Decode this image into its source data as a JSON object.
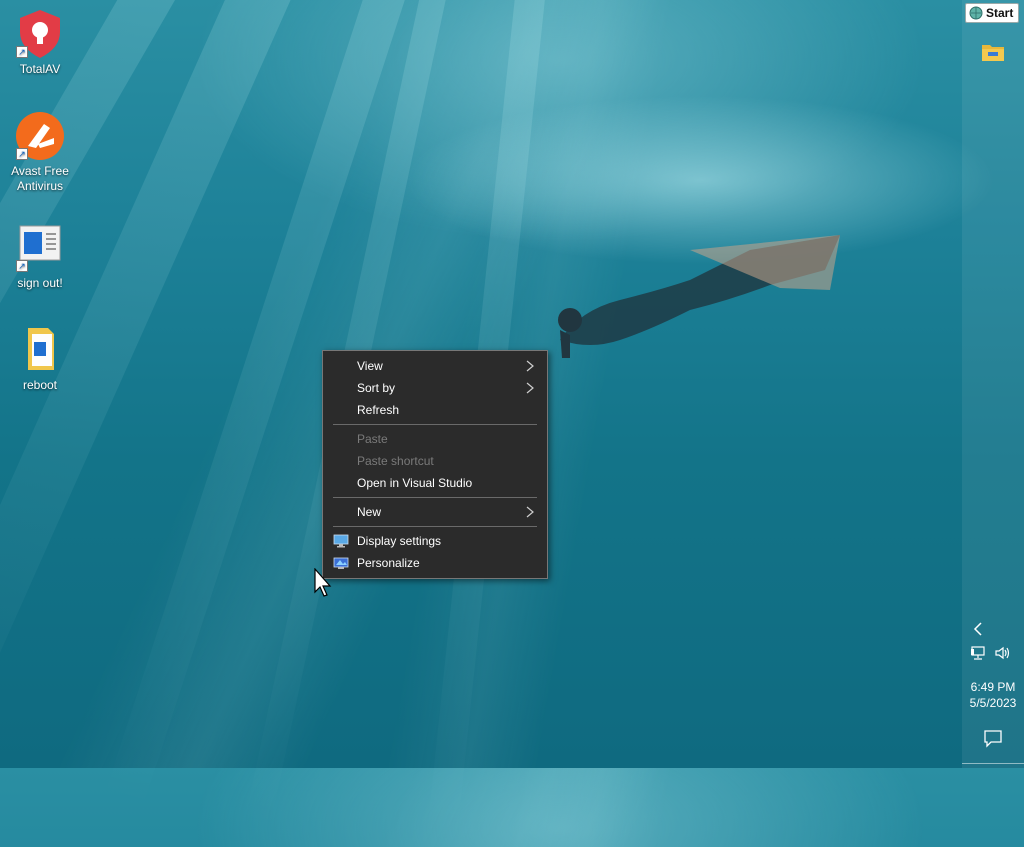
{
  "desktop_icons": [
    {
      "name": "TotalAV",
      "icon": "totalav-shield-icon"
    },
    {
      "name": "Avast Free Antivirus",
      "icon": "avast-icon"
    },
    {
      "name": "sign out!",
      "icon": "sign-out-shortcut-icon"
    },
    {
      "name": "reboot",
      "icon": "folder-file-icon"
    }
  ],
  "context_menu": {
    "items": [
      {
        "label": "View",
        "submenu": true,
        "enabled": true
      },
      {
        "label": "Sort by",
        "submenu": true,
        "enabled": true
      },
      {
        "label": "Refresh",
        "enabled": true
      },
      {
        "label": "Paste",
        "enabled": false
      },
      {
        "label": "Paste shortcut",
        "enabled": false
      },
      {
        "label": "Open in Visual Studio",
        "enabled": true
      },
      {
        "label": "New",
        "submenu": true,
        "enabled": true
      },
      {
        "label": "Display settings",
        "enabled": true,
        "icon": "display-settings-icon"
      },
      {
        "label": "Personalize",
        "enabled": true,
        "icon": "personalize-icon"
      }
    ]
  },
  "taskbar": {
    "start_label": "Start",
    "clock_time": "6:49 PM",
    "clock_date": "5/5/2023"
  },
  "colors": {
    "menu_bg": "#2b2b2b",
    "menu_text": "#ffffff",
    "menu_disabled": "#7a7a7a",
    "desktop_water": "#1d8198"
  }
}
